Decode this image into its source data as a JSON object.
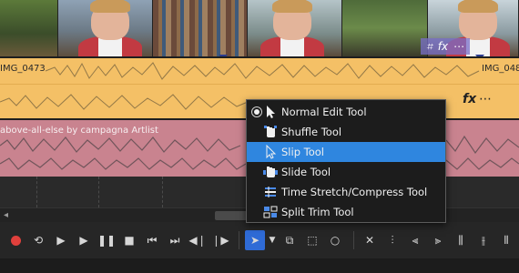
{
  "video_track": {
    "controls": {
      "crop_icon": "crop-icon",
      "fx_label": "fx",
      "more_label": "⋯"
    }
  },
  "audio_clip_1": {
    "left_label": "IMG_0473",
    "right_label": "IMG_048",
    "fx_label": "fx",
    "more_label": "⋯"
  },
  "audio_clip_2": {
    "label": "above-all-else by campagna Artlist"
  },
  "context_menu": {
    "items": [
      {
        "label": "Normal Edit Tool",
        "icon": "arrow-pointer-icon",
        "selected": true
      },
      {
        "label": "Shuffle Tool",
        "icon": "hand-shuffle-icon",
        "selected": false
      },
      {
        "label": "Slip Tool",
        "icon": "slip-pointer-icon",
        "selected": false,
        "highlighted": true
      },
      {
        "label": "Slide Tool",
        "icon": "hand-slide-icon",
        "selected": false
      },
      {
        "label": "Time Stretch/Compress Tool",
        "icon": "time-stretch-icon",
        "selected": false
      },
      {
        "label": "Split Trim Tool",
        "icon": "split-trim-icon",
        "selected": false
      }
    ]
  },
  "transport": {
    "buttons": [
      "record",
      "loop",
      "play-from-start",
      "play",
      "pause",
      "stop",
      "go-to-start",
      "go-to-end",
      "previous-frame",
      "next-frame",
      "edit-tool",
      "edit-tool-dropdown",
      "envelope-tool",
      "selection-tool",
      "zoom-tool",
      "delete",
      "trim",
      "trim-start",
      "trim-end",
      "split",
      "snap",
      "auto-ripple",
      "lock",
      "link"
    ]
  },
  "colors": {
    "audio_orange": "#f4c066",
    "audio_pink": "#c9838f",
    "menu_highlight": "#2f86df",
    "active_tool": "#2f6bd6",
    "record_red": "#e0403c"
  }
}
